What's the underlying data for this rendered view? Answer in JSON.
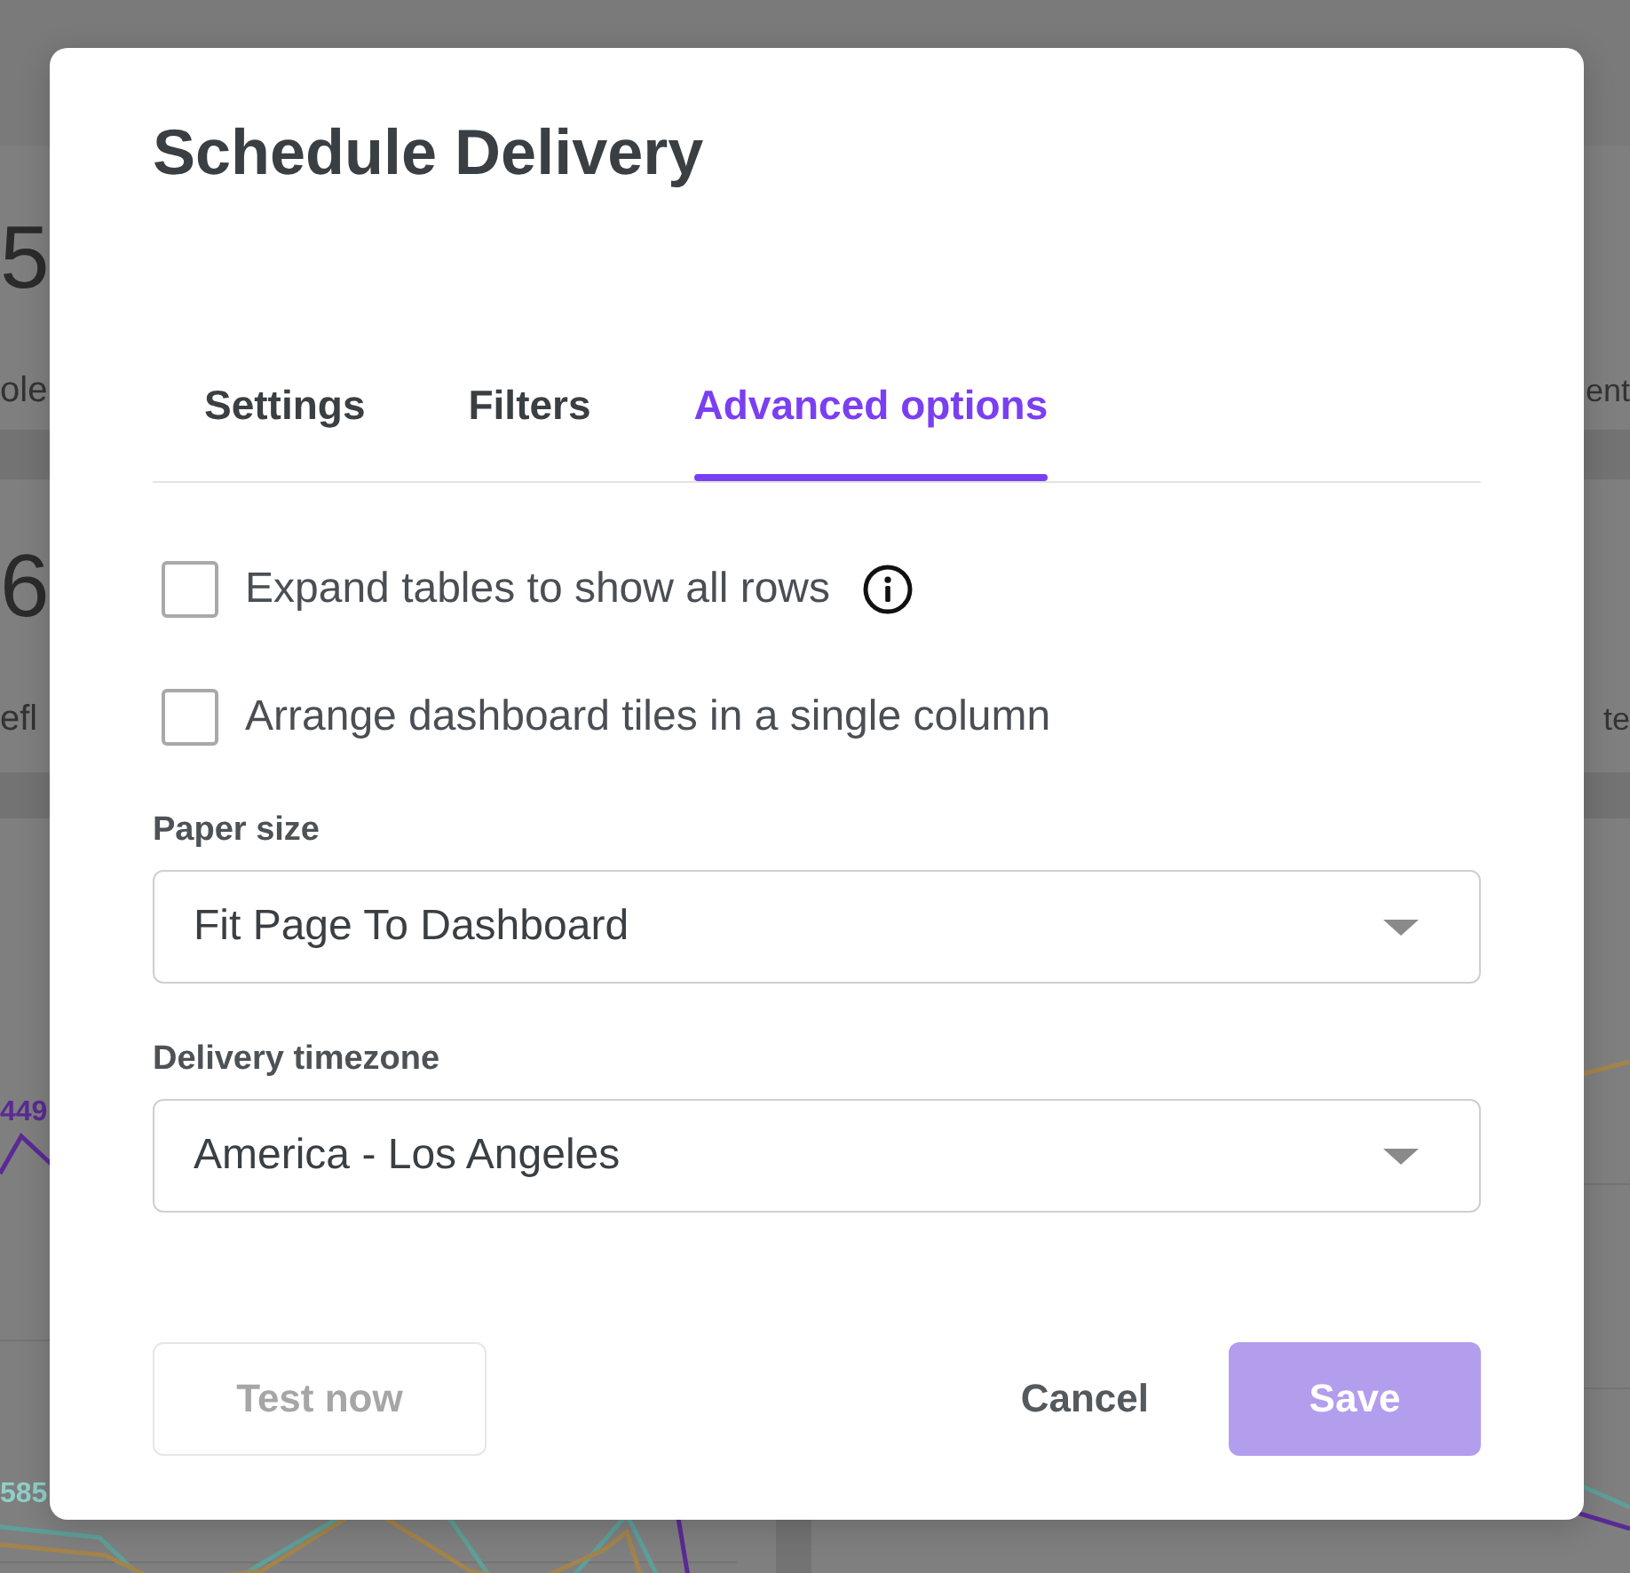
{
  "background_dashboard": {
    "tiles": [
      {
        "value": "5",
        "label": "ole"
      },
      {
        "label": "ent"
      },
      {
        "value": "6",
        "label": "efl"
      },
      {
        "label": "te"
      }
    ],
    "chart_labels": [
      {
        "text": "449",
        "color": "#5a2a95"
      },
      {
        "text": "585",
        "color": "#8fd0c8"
      }
    ]
  },
  "dialog": {
    "title": "Schedule Delivery"
  },
  "tabs": [
    {
      "label": "Settings",
      "selected": false
    },
    {
      "label": "Filters",
      "selected": false
    },
    {
      "label": "Advanced options",
      "selected": true
    }
  ],
  "options": [
    {
      "label": "Expand tables to show all rows",
      "checked": false,
      "info": true
    },
    {
      "label": "Arrange dashboard tiles in a single column",
      "checked": false,
      "info": false
    }
  ],
  "fields": [
    {
      "label": "Paper size",
      "value": "Fit Page To Dashboard"
    },
    {
      "label": "Delivery timezone",
      "value": "America - Los Angeles"
    }
  ],
  "buttons": [
    {
      "label": "Test now",
      "kind": "outline",
      "disabled": true
    },
    {
      "label": "Cancel",
      "kind": "text",
      "disabled": false
    },
    {
      "label": "Save",
      "kind": "primary",
      "disabled": true
    }
  ]
}
